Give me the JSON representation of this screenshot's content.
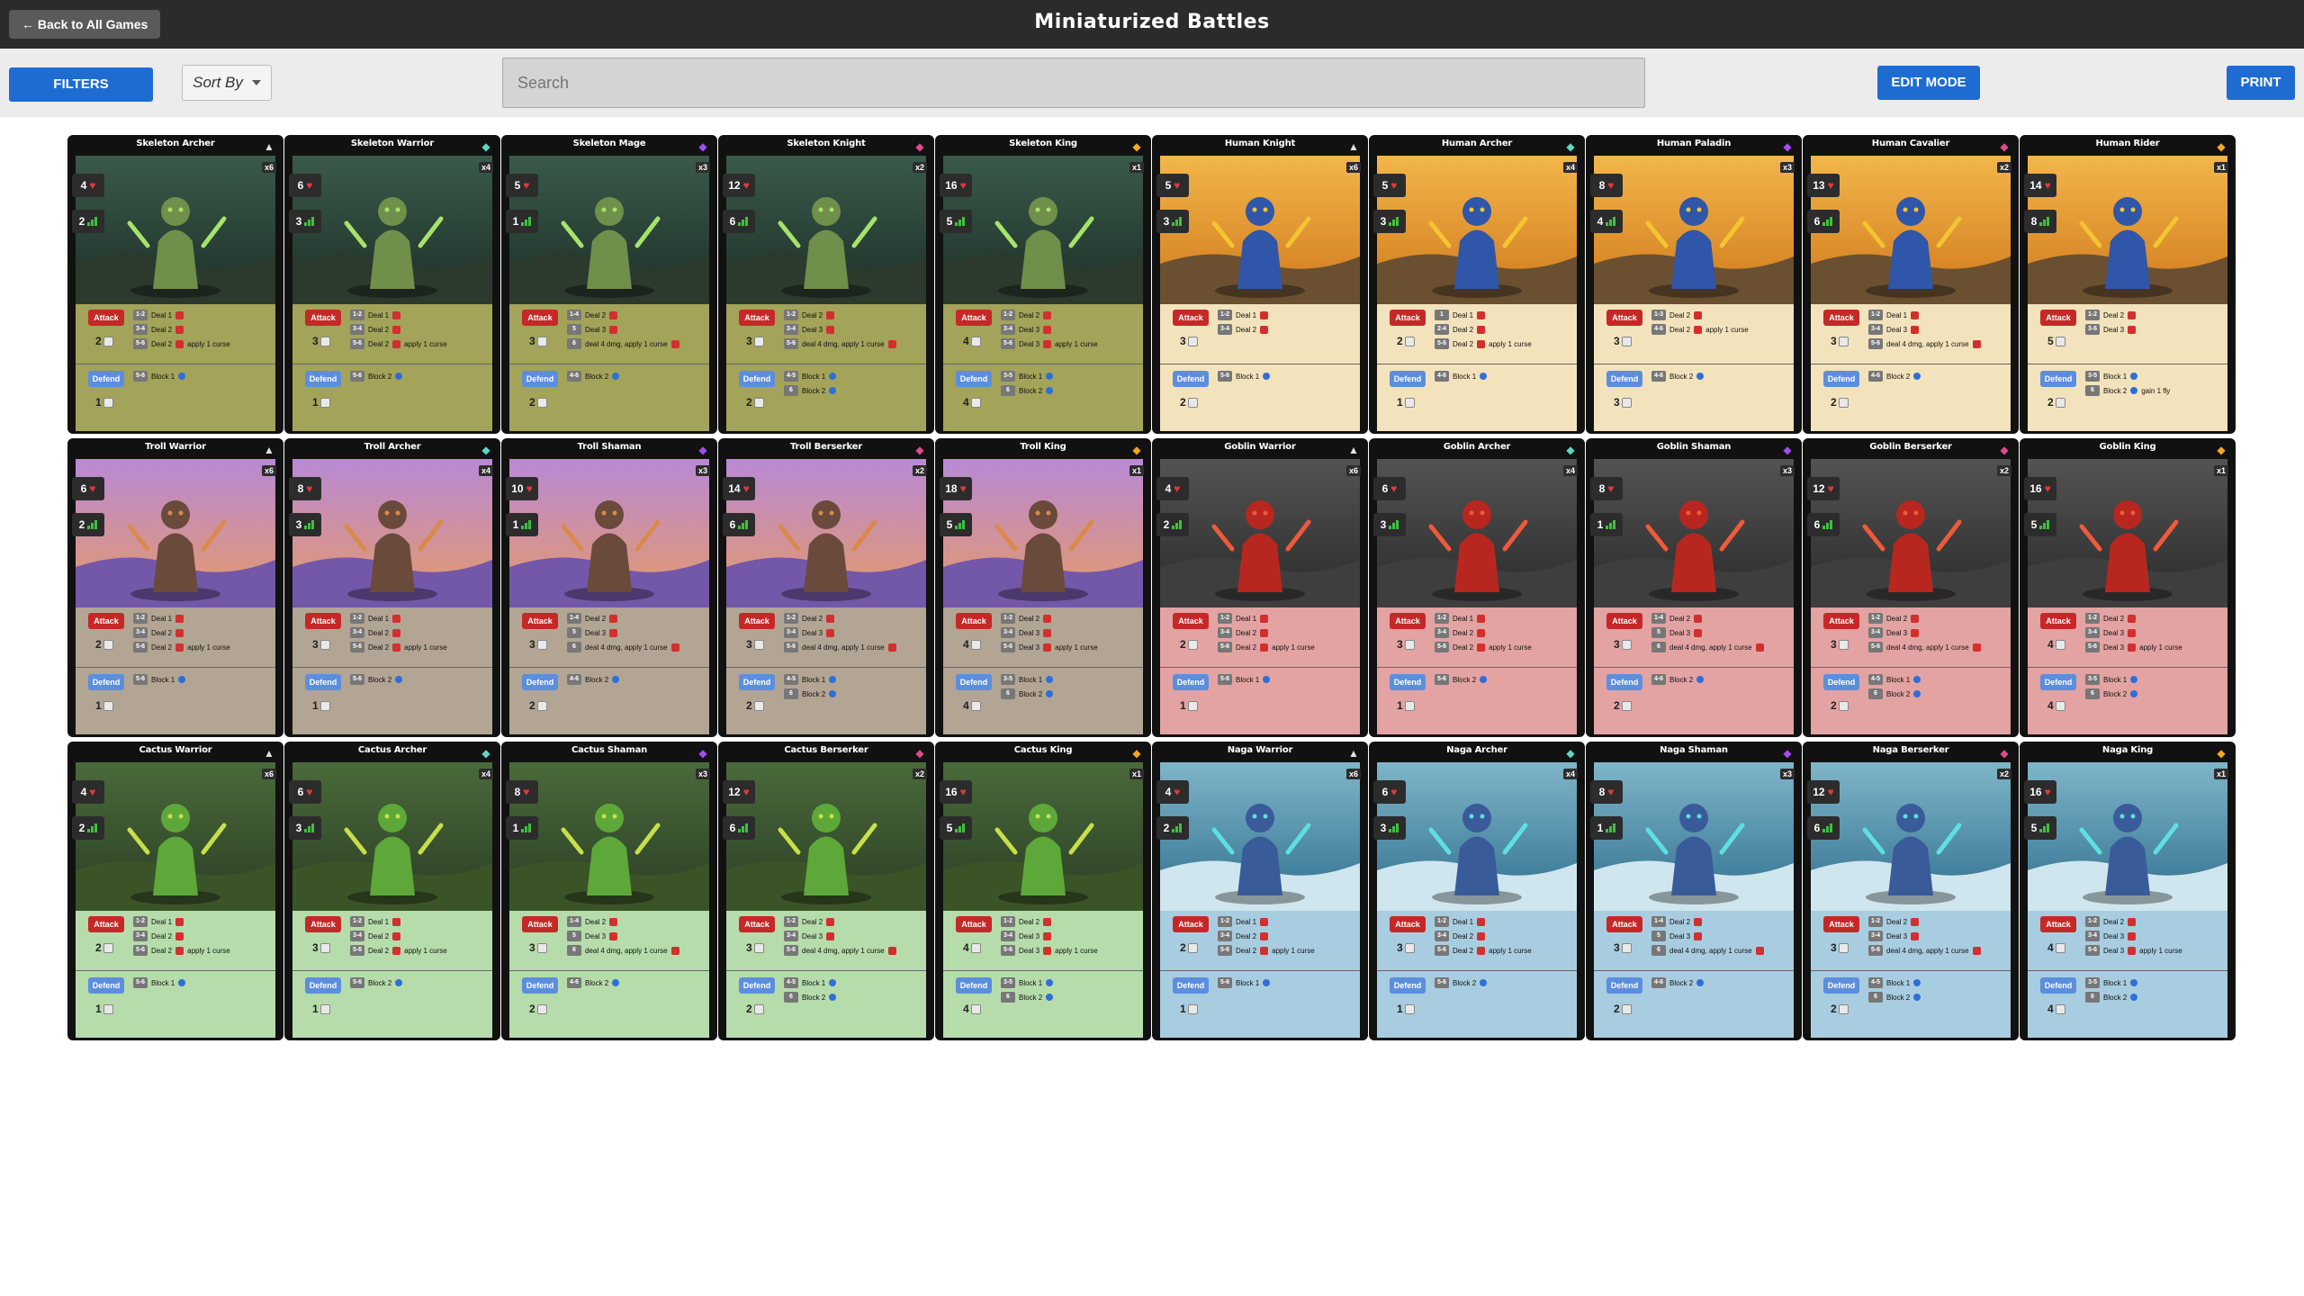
{
  "topbar": {
    "back_label": "← Back to All Games",
    "title": "Miniaturized Battles"
  },
  "toolbar": {
    "filters_label": "FILTERS",
    "sort_label": "Sort By",
    "search_placeholder": "Search",
    "edit_label": "EDIT MODE",
    "print_label": "PRINT"
  },
  "labels": {
    "attack": "Attack",
    "defend": "Defend"
  },
  "colors": {
    "accent": "#1e6cd1",
    "skeleton_panel": "#a3a35a",
    "human_panel": "#f3e3bd",
    "troll_panel": "#b3a594",
    "goblin_panel": "#e3a3a3",
    "cactus_panel": "#b6dcab",
    "naga_panel": "#a9cde0"
  },
  "tiers": [
    {
      "rarity_icon": "triangle-icon",
      "rarity_color": "#e0e0e0",
      "qty": "x6"
    },
    {
      "rarity_icon": "diamond-icon",
      "rarity_color": "#5ed6c4",
      "qty": "x4"
    },
    {
      "rarity_icon": "gem-icon",
      "rarity_color": "#a44cf0",
      "qty": "x3"
    },
    {
      "rarity_icon": "gem-icon",
      "rarity_color": "#e04a8c",
      "qty": "x2"
    },
    {
      "rarity_icon": "diamond-icon",
      "rarity_color": "#f2a81e",
      "qty": "x1"
    }
  ],
  "cards": [
    {
      "name": "Skeleton Archer",
      "hp": "4",
      "move": "2",
      "attack_dice": "2",
      "defend_dice": "1",
      "attack_rows": [
        [
          "1-2",
          "Deal 1"
        ],
        [
          "3-4",
          "Deal 2"
        ],
        [
          "5-6",
          "Deal 2",
          "apply 1 curse"
        ]
      ],
      "defend_rows": [
        [
          "5-6",
          "Block 1"
        ]
      ]
    },
    {
      "name": "Skeleton Warrior",
      "hp": "6",
      "move": "3",
      "attack_dice": "3",
      "defend_dice": "1",
      "attack_rows": [
        [
          "1-2",
          "Deal 1"
        ],
        [
          "3-4",
          "Deal 2"
        ],
        [
          "5-6",
          "Deal 2",
          "apply 1 curse"
        ]
      ],
      "defend_rows": [
        [
          "5-6",
          "Block 2"
        ]
      ]
    },
    {
      "name": "Skeleton Mage",
      "hp": "5",
      "move": "1",
      "attack_dice": "3",
      "defend_dice": "2",
      "attack_rows": [
        [
          "1-4",
          "Deal 2"
        ],
        [
          "5",
          "Deal 3"
        ],
        [
          "6",
          "deal 4 dmg, apply 1 curse"
        ]
      ],
      "defend_rows": [
        [
          "4-6",
          "Block 2"
        ]
      ]
    },
    {
      "name": "Skeleton Knight",
      "hp": "12",
      "move": "6",
      "attack_dice": "3",
      "defend_dice": "2",
      "attack_rows": [
        [
          "1-2",
          "Deal 2"
        ],
        [
          "3-4",
          "Deal 3"
        ],
        [
          "5-6",
          "deal 4 dmg, apply 1 curse"
        ]
      ],
      "defend_rows": [
        [
          "4-5",
          "Block 1"
        ],
        [
          "6",
          "Block 2"
        ]
      ]
    },
    {
      "name": "Skeleton King",
      "hp": "16",
      "move": "5",
      "attack_dice": "4",
      "defend_dice": "4",
      "attack_rows": [
        [
          "1-2",
          "Deal 2"
        ],
        [
          "3-4",
          "Deal 3"
        ],
        [
          "5-6",
          "Deal 3",
          "apply 1 curse"
        ]
      ],
      "defend_rows": [
        [
          "3-5",
          "Block 1"
        ],
        [
          "6",
          "Block 2"
        ]
      ]
    },
    {
      "name": "Human Knight",
      "hp": "5",
      "move": "3",
      "attack_dice": "3",
      "defend_dice": "2",
      "attack_rows": [
        [
          "1-2",
          "Deal 1"
        ],
        [
          "3-4",
          "Deal 2"
        ]
      ],
      "defend_rows": [
        [
          "5-6",
          "Block 1"
        ]
      ]
    },
    {
      "name": "Human Archer",
      "hp": "5",
      "move": "3",
      "attack_dice": "2",
      "defend_dice": "1",
      "attack_rows": [
        [
          "1",
          "Deal 1"
        ],
        [
          "2-4",
          "Deal 2"
        ],
        [
          "5-6",
          "Deal 2",
          "apply 1 curse"
        ]
      ],
      "defend_rows": [
        [
          "4-6",
          "Block 1"
        ]
      ]
    },
    {
      "name": "Human Paladin",
      "hp": "8",
      "move": "4",
      "attack_dice": "3",
      "defend_dice": "3",
      "attack_rows": [
        [
          "1-3",
          "Deal 2"
        ],
        [
          "4-6",
          "Deal 2",
          "apply 1 curse"
        ]
      ],
      "defend_rows": [
        [
          "4-6",
          "Block 2"
        ]
      ]
    },
    {
      "name": "Human Cavalier",
      "hp": "13",
      "move": "6",
      "attack_dice": "3",
      "defend_dice": "2",
      "attack_rows": [
        [
          "1-2",
          "Deal 1"
        ],
        [
          "3-4",
          "Deal 3"
        ],
        [
          "5-6",
          "deal 4 dmg, apply 1 curse"
        ]
      ],
      "defend_rows": [
        [
          "4-6",
          "Block 2"
        ]
      ]
    },
    {
      "name": "Human Rider",
      "hp": "14",
      "move": "8",
      "attack_dice": "5",
      "defend_dice": "2",
      "attack_rows": [
        [
          "1-2",
          "Deal 2"
        ],
        [
          "3-6",
          "Deal 3"
        ]
      ],
      "defend_rows": [
        [
          "3-5",
          "Block 1"
        ],
        [
          "6",
          "Block 2",
          "gain 1 fly"
        ]
      ]
    },
    {
      "name": "Troll Warrior",
      "hp": "6",
      "move": "2",
      "attack_dice": "2",
      "defend_dice": "1",
      "attack_rows": [
        [
          "1-2",
          "Deal 1"
        ],
        [
          "3-4",
          "Deal 2"
        ],
        [
          "5-6",
          "Deal 2",
          "apply 1 curse"
        ]
      ],
      "defend_rows": [
        [
          "5-6",
          "Block 1"
        ]
      ]
    },
    {
      "name": "Troll Archer",
      "hp": "8",
      "move": "3",
      "attack_dice": "3",
      "defend_dice": "1",
      "attack_rows": [
        [
          "1-2",
          "Deal 1"
        ],
        [
          "3-4",
          "Deal 2"
        ],
        [
          "5-6",
          "Deal 2",
          "apply 1 curse"
        ]
      ],
      "defend_rows": [
        [
          "5-6",
          "Block 2"
        ]
      ]
    },
    {
      "name": "Troll Shaman",
      "hp": "10",
      "move": "1",
      "attack_dice": "3",
      "defend_dice": "2",
      "attack_rows": [
        [
          "1-4",
          "Deal 2"
        ],
        [
          "5",
          "Deal 3"
        ],
        [
          "6",
          "deal 4 dmg, apply 1 curse"
        ]
      ],
      "defend_rows": [
        [
          "4-6",
          "Block 2"
        ]
      ]
    },
    {
      "name": "Troll Berserker",
      "hp": "14",
      "move": "6",
      "attack_dice": "3",
      "defend_dice": "2",
      "attack_rows": [
        [
          "1-2",
          "Deal 2"
        ],
        [
          "3-4",
          "Deal 3"
        ],
        [
          "5-6",
          "deal 4 dmg, apply 1 curse"
        ]
      ],
      "defend_rows": [
        [
          "4-5",
          "Block 1"
        ],
        [
          "6",
          "Block 2"
        ]
      ]
    },
    {
      "name": "Troll King",
      "hp": "18",
      "move": "5",
      "attack_dice": "4",
      "defend_dice": "4",
      "attack_rows": [
        [
          "1-2",
          "Deal 2"
        ],
        [
          "3-4",
          "Deal 3"
        ],
        [
          "5-6",
          "Deal 3",
          "apply 1 curse"
        ]
      ],
      "defend_rows": [
        [
          "3-5",
          "Block 1"
        ],
        [
          "6",
          "Block 2"
        ]
      ]
    },
    {
      "name": "Goblin Warrior",
      "hp": "4",
      "move": "2",
      "attack_dice": "2",
      "defend_dice": "1",
      "attack_rows": [
        [
          "1-2",
          "Deal 1"
        ],
        [
          "3-4",
          "Deal 2"
        ],
        [
          "5-6",
          "Deal 2",
          "apply 1 curse"
        ]
      ],
      "defend_rows": [
        [
          "5-6",
          "Block 1"
        ]
      ]
    },
    {
      "name": "Goblin Archer",
      "hp": "6",
      "move": "3",
      "attack_dice": "3",
      "defend_dice": "1",
      "attack_rows": [
        [
          "1-2",
          "Deal 1"
        ],
        [
          "3-4",
          "Deal 2"
        ],
        [
          "5-6",
          "Deal 2",
          "apply 1 curse"
        ]
      ],
      "defend_rows": [
        [
          "5-6",
          "Block 2"
        ]
      ]
    },
    {
      "name": "Goblin Shaman",
      "hp": "8",
      "move": "1",
      "attack_dice": "3",
      "defend_dice": "2",
      "attack_rows": [
        [
          "1-4",
          "Deal 2"
        ],
        [
          "5",
          "Deal 3"
        ],
        [
          "6",
          "deal 4 dmg, apply 1 curse"
        ]
      ],
      "defend_rows": [
        [
          "4-6",
          "Block 2"
        ]
      ]
    },
    {
      "name": "Goblin Berserker",
      "hp": "12",
      "move": "6",
      "attack_dice": "3",
      "defend_dice": "2",
      "attack_rows": [
        [
          "1-2",
          "Deal 2"
        ],
        [
          "3-4",
          "Deal 3"
        ],
        [
          "5-6",
          "deal 4 dmg, apply 1 curse"
        ]
      ],
      "defend_rows": [
        [
          "4-5",
          "Block 1"
        ],
        [
          "6",
          "Block 2"
        ]
      ]
    },
    {
      "name": "Goblin King",
      "hp": "16",
      "move": "5",
      "attack_dice": "4",
      "defend_dice": "4",
      "attack_rows": [
        [
          "1-2",
          "Deal 2"
        ],
        [
          "3-4",
          "Deal 3"
        ],
        [
          "5-6",
          "Deal 3",
          "apply 1 curse"
        ]
      ],
      "defend_rows": [
        [
          "3-5",
          "Block 1"
        ],
        [
          "6",
          "Block 2"
        ]
      ]
    },
    {
      "name": "Cactus Warrior",
      "hp": "4",
      "move": "2",
      "attack_dice": "2",
      "defend_dice": "1",
      "attack_rows": [
        [
          "1-2",
          "Deal 1"
        ],
        [
          "3-4",
          "Deal 2"
        ],
        [
          "5-6",
          "Deal 2",
          "apply 1 curse"
        ]
      ],
      "defend_rows": [
        [
          "5-6",
          "Block 1"
        ]
      ]
    },
    {
      "name": "Cactus Archer",
      "hp": "6",
      "move": "3",
      "attack_dice": "3",
      "defend_dice": "1",
      "attack_rows": [
        [
          "1-2",
          "Deal 1"
        ],
        [
          "3-4",
          "Deal 2"
        ],
        [
          "5-6",
          "Deal 2",
          "apply 1 curse"
        ]
      ],
      "defend_rows": [
        [
          "5-6",
          "Block 2"
        ]
      ]
    },
    {
      "name": "Cactus Shaman",
      "hp": "8",
      "move": "1",
      "attack_dice": "3",
      "defend_dice": "2",
      "attack_rows": [
        [
          "1-4",
          "Deal 2"
        ],
        [
          "5",
          "Deal 3"
        ],
        [
          "6",
          "deal 4 dmg, apply 1 curse"
        ]
      ],
      "defend_rows": [
        [
          "4-6",
          "Block 2"
        ]
      ]
    },
    {
      "name": "Cactus Berserker",
      "hp": "12",
      "move": "6",
      "attack_dice": "3",
      "defend_dice": "2",
      "attack_rows": [
        [
          "1-2",
          "Deal 2"
        ],
        [
          "3-4",
          "Deal 3"
        ],
        [
          "5-6",
          "deal 4 dmg, apply 1 curse"
        ]
      ],
      "defend_rows": [
        [
          "4-5",
          "Block 1"
        ],
        [
          "6",
          "Block 2"
        ]
      ]
    },
    {
      "name": "Cactus King",
      "hp": "16",
      "move": "5",
      "attack_dice": "4",
      "defend_dice": "4",
      "attack_rows": [
        [
          "1-2",
          "Deal 2"
        ],
        [
          "3-4",
          "Deal 3"
        ],
        [
          "5-6",
          "Deal 3",
          "apply 1 curse"
        ]
      ],
      "defend_rows": [
        [
          "3-5",
          "Block 1"
        ],
        [
          "6",
          "Block 2"
        ]
      ]
    },
    {
      "name": "Naga Warrior",
      "hp": "4",
      "move": "2",
      "attack_dice": "2",
      "defend_dice": "1",
      "attack_rows": [
        [
          "1-2",
          "Deal 1"
        ],
        [
          "3-4",
          "Deal 2"
        ],
        [
          "5-6",
          "Deal 2",
          "apply 1 curse"
        ]
      ],
      "defend_rows": [
        [
          "5-6",
          "Block 1"
        ]
      ]
    },
    {
      "name": "Naga Archer",
      "hp": "6",
      "move": "3",
      "attack_dice": "3",
      "defend_dice": "1",
      "attack_rows": [
        [
          "1-2",
          "Deal 1"
        ],
        [
          "3-4",
          "Deal 2"
        ],
        [
          "5-6",
          "Deal 2",
          "apply 1 curse"
        ]
      ],
      "defend_rows": [
        [
          "5-6",
          "Block 2"
        ]
      ]
    },
    {
      "name": "Naga Shaman",
      "hp": "8",
      "move": "1",
      "attack_dice": "3",
      "defend_dice": "2",
      "attack_rows": [
        [
          "1-4",
          "Deal 2"
        ],
        [
          "5",
          "Deal 3"
        ],
        [
          "6",
          "deal 4 dmg, apply 1 curse"
        ]
      ],
      "defend_rows": [
        [
          "4-6",
          "Block 2"
        ]
      ]
    },
    {
      "name": "Naga Berserker",
      "hp": "12",
      "move": "6",
      "attack_dice": "3",
      "defend_dice": "2",
      "attack_rows": [
        [
          "1-2",
          "Deal 2"
        ],
        [
          "3-4",
          "Deal 3"
        ],
        [
          "5-6",
          "deal 4 dmg, apply 1 curse"
        ]
      ],
      "defend_rows": [
        [
          "4-5",
          "Block 1"
        ],
        [
          "6",
          "Block 2"
        ]
      ]
    },
    {
      "name": "Naga King",
      "hp": "16",
      "move": "5",
      "attack_dice": "4",
      "defend_dice": "4",
      "attack_rows": [
        [
          "1-2",
          "Deal 2"
        ],
        [
          "3-4",
          "Deal 3"
        ],
        [
          "5-6",
          "Deal 3",
          "apply 1 curse"
        ]
      ],
      "defend_rows": [
        [
          "3-5",
          "Block 1"
        ],
        [
          "6",
          "Block 2"
        ]
      ]
    }
  ]
}
